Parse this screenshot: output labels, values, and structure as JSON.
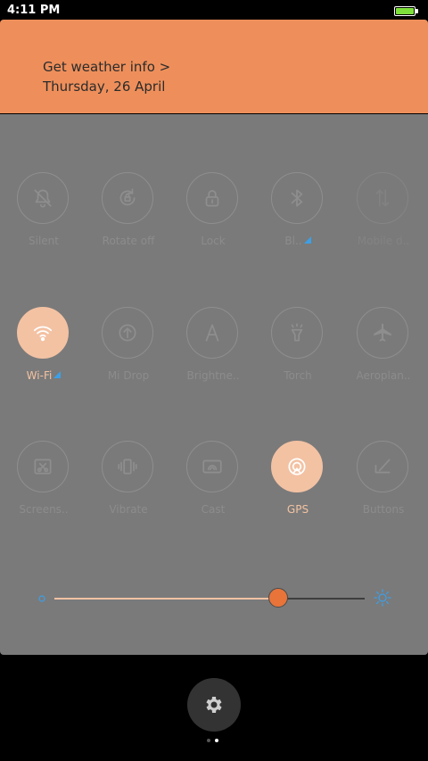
{
  "status": {
    "time": "4:11 PM"
  },
  "weather": {
    "title": "Get weather info >",
    "date": "Thursday, 26 April"
  },
  "toggles": [
    {
      "label": "Silent",
      "icon": "bell-off-icon",
      "state": "off"
    },
    {
      "label": "Rotate off",
      "icon": "rotate-lock-icon",
      "state": "off"
    },
    {
      "label": "Lock",
      "icon": "lock-icon",
      "state": "off"
    },
    {
      "label": "Bl..",
      "icon": "bluetooth-icon",
      "state": "off"
    },
    {
      "label": "Mobile d..",
      "icon": "mobile-data-icon",
      "state": "disabled"
    },
    {
      "label": "Wi-Fi",
      "icon": "wifi-icon",
      "state": "on"
    },
    {
      "label": "Mi Drop",
      "icon": "mi-drop-icon",
      "state": "off"
    },
    {
      "label": "Brightne..",
      "icon": "auto-brightness-icon",
      "state": "off"
    },
    {
      "label": "Torch",
      "icon": "torch-icon",
      "state": "off"
    },
    {
      "label": "Aeroplan..",
      "icon": "airplane-icon",
      "state": "off"
    },
    {
      "label": "Screens..",
      "icon": "screenshot-icon",
      "state": "off"
    },
    {
      "label": "Vibrate",
      "icon": "vibrate-icon",
      "state": "off"
    },
    {
      "label": "Cast",
      "icon": "cast-icon",
      "state": "off"
    },
    {
      "label": "GPS",
      "icon": "gps-icon",
      "state": "on"
    },
    {
      "label": "Buttons",
      "icon": "buttons-icon",
      "state": "off"
    }
  ],
  "brightness": {
    "level": 0.72
  },
  "colors": {
    "accent": "#ee8f5b",
    "toggle_on": "#f3c2a3",
    "slider_thumb": "#e8743a",
    "signal": "#3d9fe6",
    "battery": "#7ee03a"
  },
  "pager": {
    "pages": 2,
    "active": 1
  }
}
